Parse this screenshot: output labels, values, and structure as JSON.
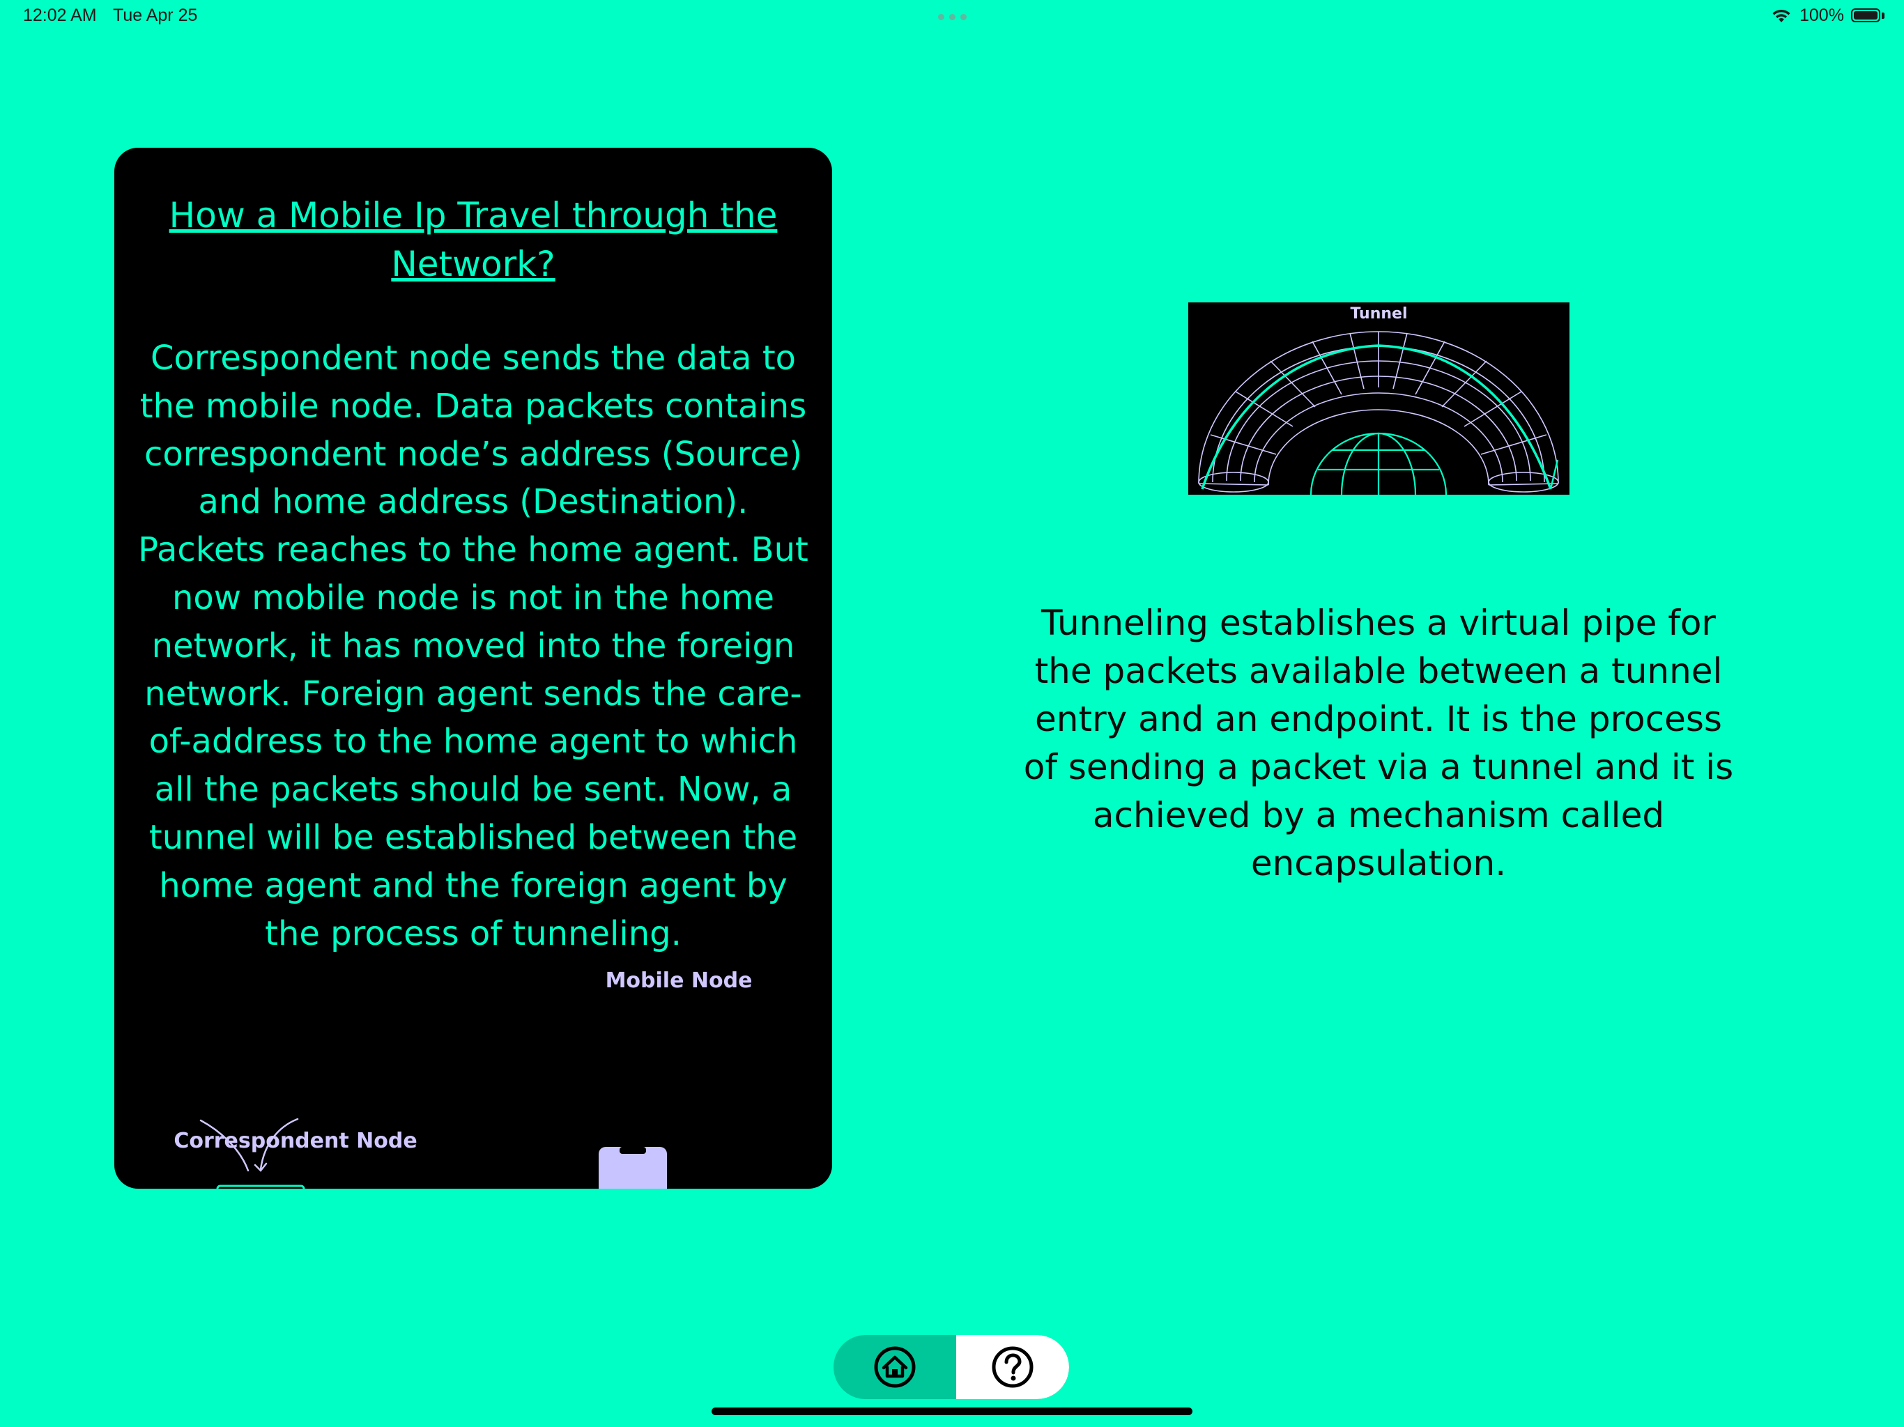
{
  "status_bar": {
    "time": "12:02 AM",
    "date": "Tue Apr 25",
    "battery_percent": "100%",
    "icons": [
      "wifi-icon",
      "battery-icon"
    ]
  },
  "card": {
    "title_line1": "How a Mobile Ip Travel through the",
    "title_line2": "Network?",
    "body": "Correspondent node sends the data to the mobile node. Data packets contains correspondent node’s address (Source) and home address (Destination). Packets reaches to the home agent. But now mobile node is not in the home network, it has moved into the foreign network. Foreign agent sends the care-of-address to the home agent to which all the packets should be sent. Now, a tunnel will be established between the home agent and the foreign agent by the process of tunneling.",
    "illustration": {
      "mobile_label": "Mobile Node",
      "correspondent_label": "Correspondent Node"
    }
  },
  "tunnel_image": {
    "label": "Tunnel"
  },
  "right_text": "Tunneling establishes a virtual pipe for the packets available between a tunnel entry and an endpoint. It is the process of sending a packet via a tunnel and it is achieved by a mechanism called encapsulation.",
  "bottom_nav": {
    "buttons": [
      {
        "name": "home",
        "icon": "home-icon"
      },
      {
        "name": "help",
        "icon": "question-icon"
      }
    ]
  },
  "colors": {
    "background": "#00FFC4",
    "card": "#000000",
    "accent_text": "#00FFC4",
    "lavender": "#C8C4FF"
  }
}
